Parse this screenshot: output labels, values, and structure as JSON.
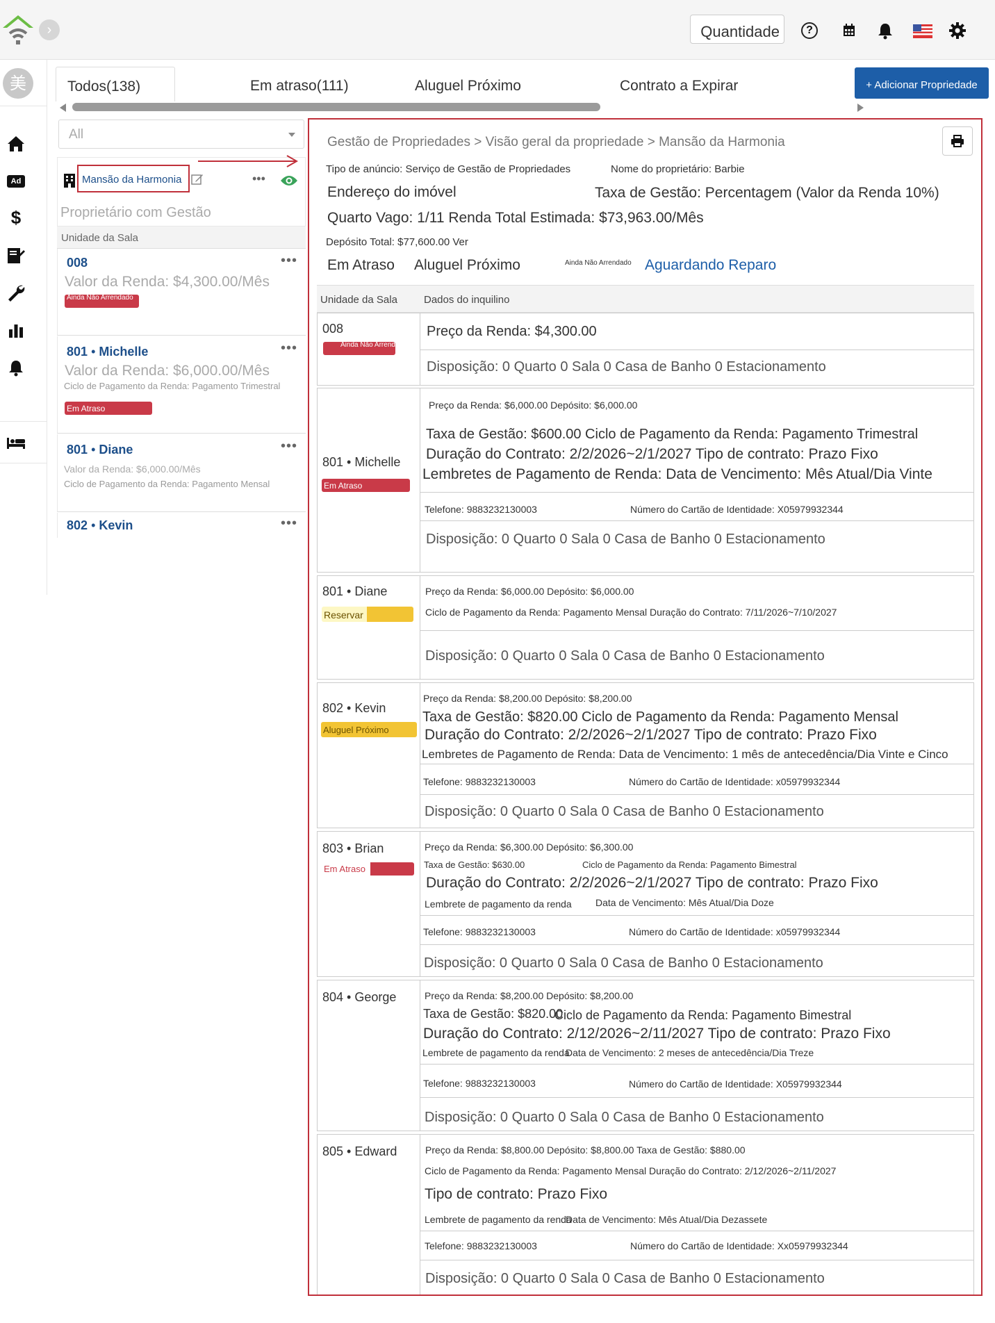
{
  "topbar": {
    "quantity_label": "Quantidade",
    "icons": [
      "help-icon",
      "calendar-icon",
      "bell-icon",
      "us-flag-icon",
      "gear-icon"
    ],
    "collapse_icon": "chevron-right-icon"
  },
  "leftnav": {
    "avatar_char": "美",
    "items": [
      "home-icon",
      "ad-icon",
      "dollar-icon",
      "contract-sign-icon",
      "wrench-icon",
      "bar-chart-icon",
      "bell-icon",
      "bed-icon"
    ],
    "ad_text": "Ad"
  },
  "tabs": [
    {
      "label": "Todos(138)"
    },
    {
      "label": "Em atraso(111)"
    },
    {
      "label": "Aluguel Próximo"
    },
    {
      "label": "Contrato a Expirar"
    }
  ],
  "add_button": "+ Adicionar Propriedade",
  "filter": {
    "value": "All"
  },
  "property": {
    "name": "Mansão da Harmonia",
    "subtitle": "Proprietário com Gestão",
    "dots": "•••"
  },
  "list": {
    "header": "Unidade da Sala",
    "items": [
      {
        "unit": "008",
        "tenant": "",
        "rent": "Valor da Renda: $4,300.00/Mês",
        "cycle": "",
        "status": "Ainda Não Arrendado"
      },
      {
        "unit": "801",
        "tenant": "Michelle",
        "rent": "Valor da Renda: $6,000.00/Mês",
        "cycle": "Ciclo de Pagamento da Renda: Pagamento Trimestral",
        "status": "Em Atraso"
      },
      {
        "unit": "801",
        "tenant": "Diane",
        "rent": "Valor da Renda: $6,000.00/Mês",
        "cycle": "Ciclo de Pagamento da Renda: Pagamento Mensal",
        "status": ""
      },
      {
        "unit": "802",
        "tenant": "Kevin",
        "rent": "",
        "cycle": "",
        "status": ""
      }
    ],
    "sep": "•"
  },
  "detail": {
    "breadcrumb": "Gestão de Propriedades > Visão geral da propriedade > Mansão da Harmonia",
    "listing_type": "Tipo de anúncio: Serviço de Gestão de Propriedades",
    "owner": "Nome do proprietário: Barbie",
    "address_label": "Endereço do imóvel",
    "management_fee": "Taxa de Gestão: Percentagem (Valor da Renda 10%)",
    "vacancy": "Quarto Vago: 1/11 Renda Total Estimada: $73,963.00/Mês",
    "deposit_total": "Depósito Total: $77,600.00 Ver",
    "status_links": [
      "Em Atraso",
      "Aluguel Próximo",
      "Ainda Não Arrendado",
      "Aguardando Reparo"
    ],
    "table_headers": [
      "Unidade da Sala",
      "Dados do inquilino"
    ],
    "disposition": "Disposição: 0 Quarto 0 Sala 0 Casa de Banho 0 Estacionamento",
    "rows": [
      {
        "unit": "008",
        "status": "Ainda Não Arrendado",
        "rent": "Preço da Renda: $4,300.00"
      },
      {
        "unit": "801 • Michelle",
        "status": "Em Atraso",
        "rent_deposit": "Preço da Renda: $6,000.00   Depósito: $6,000.00",
        "fee_cycle": "Taxa de Gestão: $600.00 Ciclo de Pagamento da Renda: Pagamento Trimestral",
        "contract": "Duração do Contrato: 2/2/2026~2/1/2027 Tipo de contrato: Prazo Fixo",
        "reminder": "Lembretes de Pagamento de Renda: Data de Vencimento: Mês Atual/Dia Vinte",
        "phone": "Telefone: 9883232130003",
        "id_card": "Número do Cartão de Identidade: X05979932344"
      },
      {
        "unit": "801 • Diane",
        "status": "Reservar",
        "rent_deposit": "Preço da Renda: $6,000.00   Depósito: $6,000.00",
        "cycle_contract": "Ciclo de Pagamento da Renda: Pagamento Mensal Duração do Contrato: 7/11/2026~7/10/2027"
      },
      {
        "unit": "802 • Kevin",
        "status": "Aluguel Próximo",
        "rent_deposit": "Preço da Renda: $8,200.00   Depósito: $8,200.00",
        "fee_cycle": "Taxa de Gestão: $820.00 Ciclo de Pagamento da Renda: Pagamento Mensal",
        "contract": "Duração do Contrato: 2/2/2026~2/1/2027 Tipo de contrato: Prazo Fixo",
        "reminder": "Lembretes de Pagamento de Renda: Data de Vencimento: 1 mês de antecedência/Dia Vinte e Cinco",
        "phone": "Telefone: 9883232130003",
        "id_card": "Número do Cartão de Identidade: x05979932344"
      },
      {
        "unit": "803 • Brian",
        "status": "Em Atraso",
        "rent_deposit": "Preço da Renda: $6,300.00   Depósito: $6,300.00",
        "fee": "Taxa de Gestão: $630.00",
        "cycle": "Ciclo de Pagamento da Renda: Pagamento Bimestral",
        "contract": "Duração do Contrato: 2/2/2026~2/1/2027 Tipo de contrato: Prazo Fixo",
        "reminder_label": "Lembrete de pagamento da renda",
        "due": "Data de Vencimento: Mês Atual/Dia Doze",
        "phone": "Telefone: 9883232130003",
        "id_card": "Número do Cartão de Identidade: x05979932344"
      },
      {
        "unit": "804 • George",
        "status": "",
        "rent_deposit": "Preço da Renda: $8,200.00   Depósito: $8,200.00",
        "fee": "Taxa de Gestão: $820.00",
        "cycle": "Ciclo de Pagamento da Renda: Pagamento Bimestral",
        "contract": "Duração do Contrato: 2/12/2026~2/11/2027 Tipo de contrato: Prazo Fixo",
        "reminder_label": "Lembrete de pagamento da renda",
        "due": "Data de Vencimento: 2 meses de antecedência/Dia Treze",
        "phone": "Telefone: 9883232130003",
        "id_card": "Número do Cartão de Identidade: X05979932344"
      },
      {
        "unit": "805 • Edward",
        "status": "",
        "rent_deposit": "Preço da Renda: $8,800.00   Depósito: $8,800.00 Taxa de Gestão: $880.00",
        "cycle_contract": "Ciclo de Pagamento da Renda: Pagamento Mensal Duração do Contrato: 2/12/2026~2/11/2027",
        "contract_type": "Tipo de contrato: Prazo Fixo",
        "reminder_label": "Lembrete de pagamento da renda",
        "due": "Data de Vencimento: Mês Atual/Dia Dezassete",
        "phone": "Telefone: 9883232130003",
        "id_card": "Número do Cartão de Identidade: Xx05979932344"
      }
    ]
  },
  "colors": {
    "accent": "#1d5ea8",
    "overdue": "#c93a48",
    "reserve": "#f2c434",
    "highlight_border": "#c0303a",
    "logo_green": "#6cbd45"
  }
}
